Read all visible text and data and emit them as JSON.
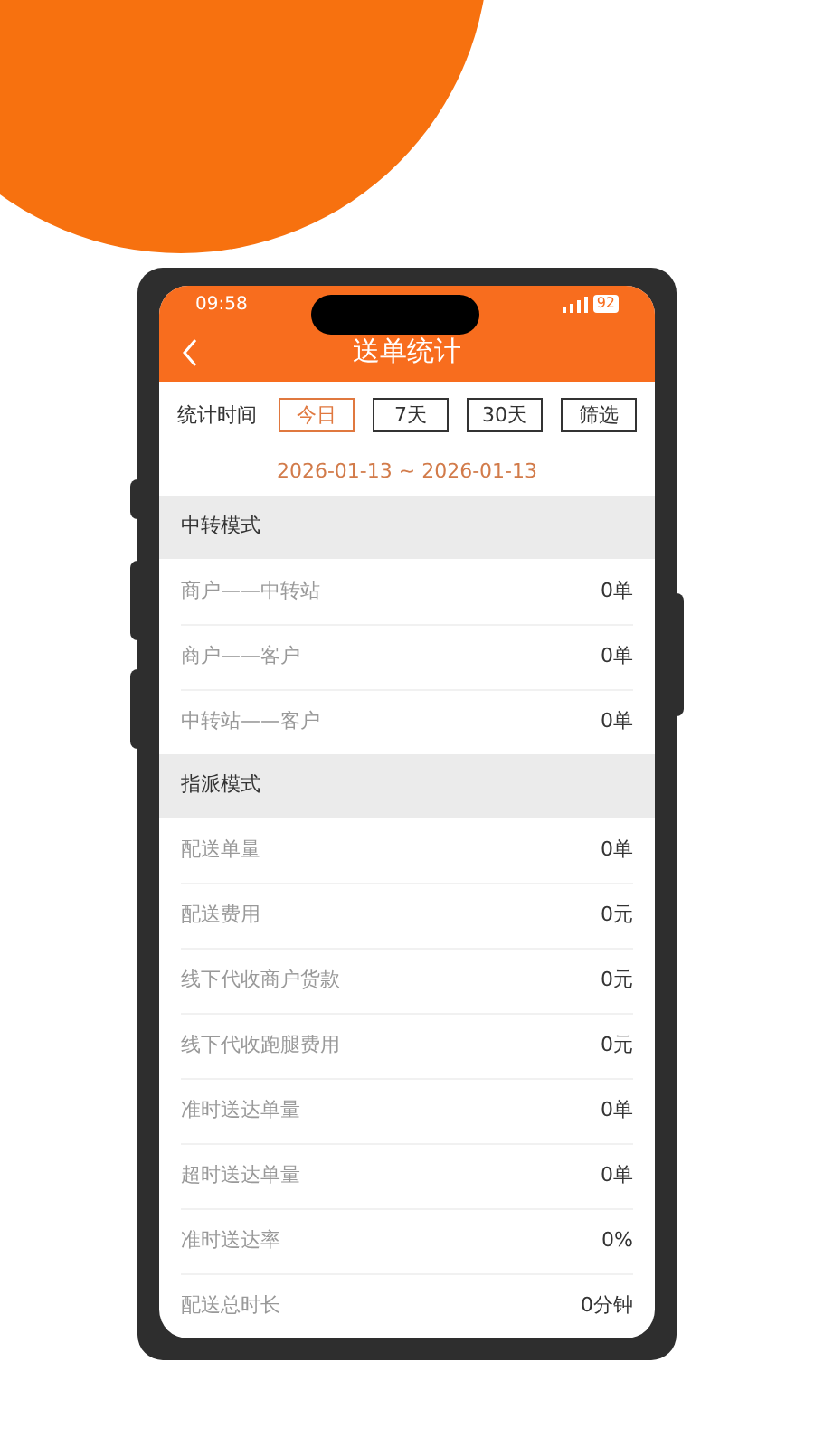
{
  "status_bar": {
    "time": "09:58",
    "battery": "92"
  },
  "header": {
    "title": "送单统计"
  },
  "filter": {
    "label": "统计时间",
    "options": [
      {
        "label": "今日",
        "selected": true
      },
      {
        "label": "7天",
        "selected": false
      },
      {
        "label": "30天",
        "selected": false
      },
      {
        "label": "筛选",
        "selected": false
      }
    ]
  },
  "date_range": "2026-01-13 ~ 2026-01-13",
  "sections": [
    {
      "title": "中转模式",
      "rows": [
        {
          "label": "商户——中转站",
          "value": "0单"
        },
        {
          "label": "商户——客户",
          "value": "0单"
        },
        {
          "label": "中转站——客户",
          "value": "0单"
        }
      ]
    },
    {
      "title": "指派模式",
      "rows": [
        {
          "label": "配送单量",
          "value": "0单"
        },
        {
          "label": "配送费用",
          "value": "0元"
        },
        {
          "label": "线下代收商户货款",
          "value": "0元"
        },
        {
          "label": "线下代收跑腿费用",
          "value": "0元"
        },
        {
          "label": "准时送达单量",
          "value": "0单"
        },
        {
          "label": "超时送达单量",
          "value": "0单"
        },
        {
          "label": "准时送达率",
          "value": "0%"
        },
        {
          "label": "配送总时长",
          "value": "0分钟"
        }
      ]
    }
  ]
}
